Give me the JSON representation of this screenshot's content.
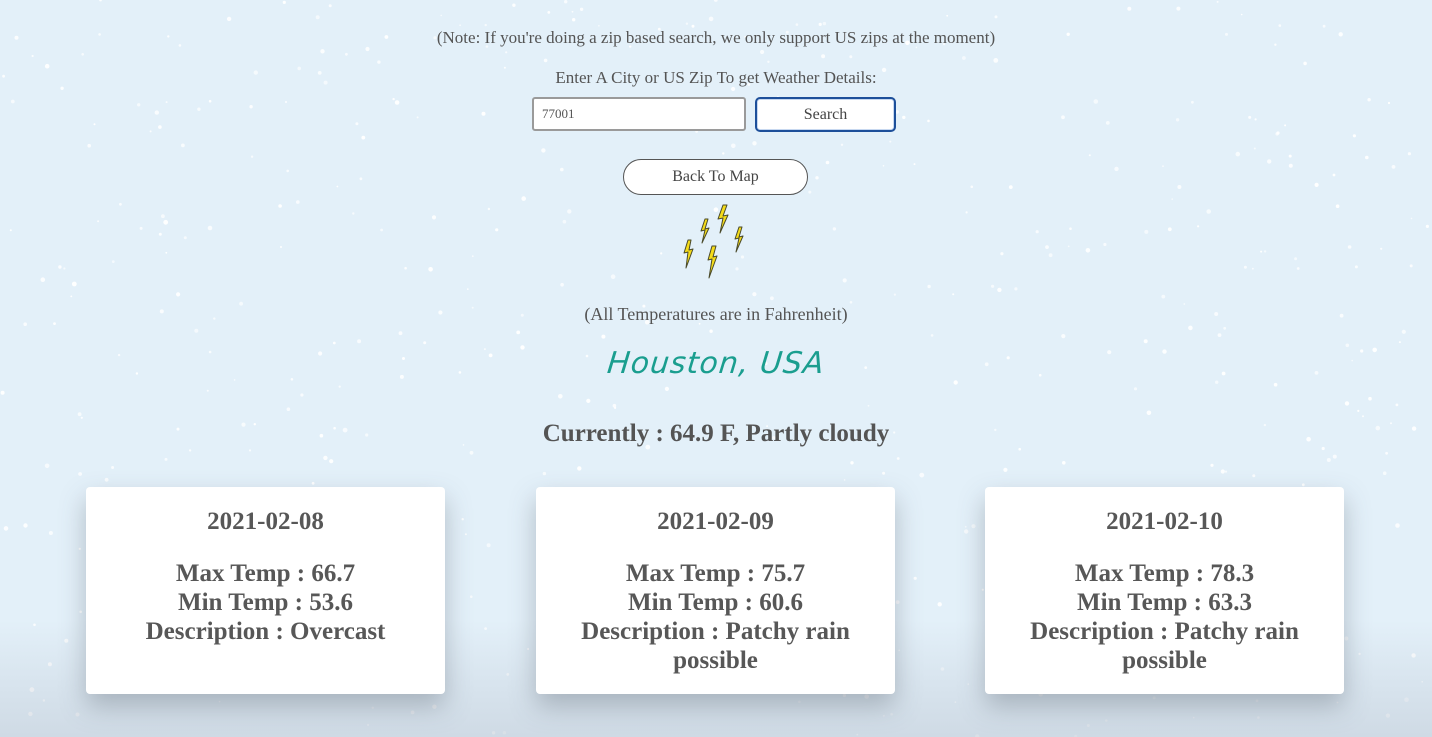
{
  "note": "(Note: If you're doing a zip based search, we only support US zips at the moment)",
  "search": {
    "prompt": "Enter A City or US Zip To get Weather Details:",
    "value": "77001",
    "button_label": "Search"
  },
  "back_button_label": "Back To Map",
  "weather_icon": "lightning-bolts-icon",
  "units_note": "(All Temperatures are in Fahrenheit)",
  "city": "Houston, USA",
  "current": "Currently : 64.9 F, Partly cloudy",
  "forecast": [
    {
      "date": "2021-02-08",
      "max": "Max Temp : 66.7",
      "min": "Min Temp : 53.6",
      "description": "Description : Overcast"
    },
    {
      "date": "2021-02-09",
      "max": "Max Temp : 75.7",
      "min": "Min Temp : 60.6",
      "description": "Description : Patchy rain possible"
    },
    {
      "date": "2021-02-10",
      "max": "Max Temp : 78.3",
      "min": "Min Temp : 63.3",
      "description": "Description : Patchy rain possible"
    }
  ],
  "colors": {
    "background": "#e3f0f9",
    "city_text": "#1a9e8f",
    "search_border": "#1d4f9a",
    "bolt_fill": "#f5dc1a"
  }
}
